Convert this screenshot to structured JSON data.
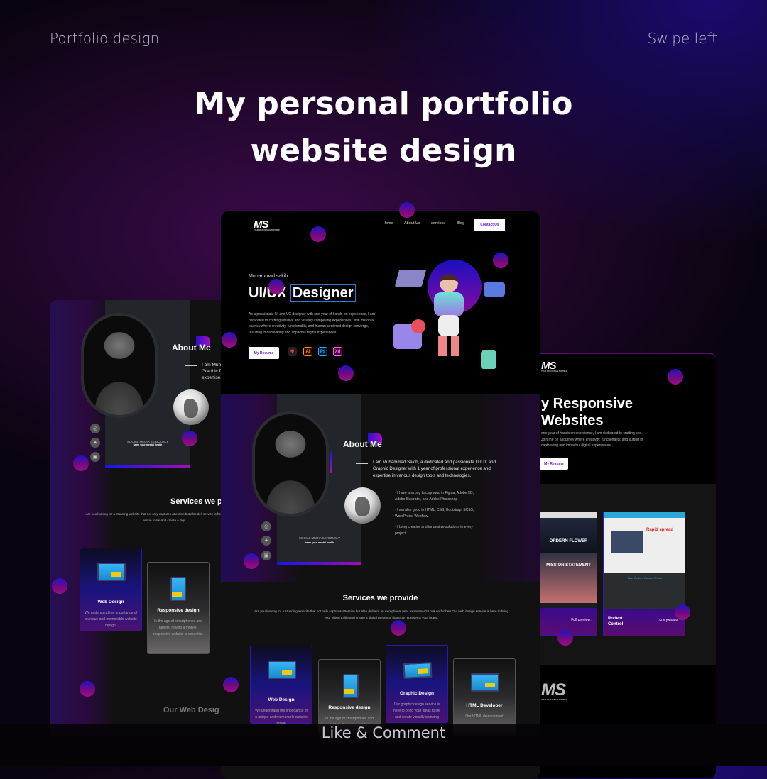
{
  "header": {
    "left_label": "Portfolio design",
    "right_label": "Swipe left",
    "title_line1": "My personal portfolio",
    "title_line2": "website design"
  },
  "footer": {
    "cta": "Like & Comment"
  },
  "site": {
    "logo": "MS",
    "logo_tagline": "YOUR WEB DESIGN PARTNER",
    "nav": [
      "Home",
      "About Us",
      "services",
      "Blog"
    ],
    "contact_button": "Contact Us",
    "hero": {
      "name": "Muhammad sakib",
      "role_prefix": "UI/UX",
      "role_highlight": "Designer",
      "description": "As a passionate UI and UX designer with one year of hands-on experience, I am dedicated to crafting intuitive and visually compelling experiences. Join me on a journey where creativity, functionality, and human-centered design converge, resulting in captivating and impactful digital experiences.",
      "resume_button": "My Resume",
      "tools": [
        {
          "name": "figma-icon",
          "label": ""
        },
        {
          "name": "illustrator-icon",
          "label": "Ai"
        },
        {
          "name": "photoshop-icon",
          "label": "Ps"
        },
        {
          "name": "xd-icon",
          "label": "Xd"
        }
      ]
    },
    "about": {
      "title": "About Me",
      "intro": "I am Muhammad Sakib, a dedicated and passionate UI/UX and Graphic Designer with 1 year of professional experience and expertise in various design tools and technologies.",
      "intro_partial": [
        "I am Muh",
        "Graphic D",
        "expertise"
      ],
      "bullets": [
        "I have a strong background in Figma, Adobe XD, Adobe Illustrator, and Adobe Photoshop .",
        "I am also good in HTML, CSS, Bootstrap, SCSS, WordPress, Webflow.",
        "I bring creative and innovative solutions to every project."
      ],
      "social_caption": "SOCIAL MEDIA SERIOUSLY",
      "social_sub": "harm your mental health",
      "socials": [
        "instagram-icon",
        "twitter-icon",
        "facebook-icon"
      ]
    },
    "services": {
      "title": "Services we provide",
      "title_partial": "Services we p",
      "description": "Are you looking for a stunning website that not only captures attention but also delivers an exceptional user experience? Look no further! Our web design service is here to bring your vision to life and create a digital presence that truly represents your brand.",
      "description_partial": "Are you looking for a stunning website that not only captures attention but also deli service is here to bring your vision to life and create a digi",
      "cards": [
        {
          "title": "Web Design",
          "text": "We understand the importance of a unique and memorable website design."
        },
        {
          "title": "Responsive design",
          "text": "In the age of smartphones and tablets, having a mobile-responsive website is essential."
        },
        {
          "title": "Graphic Design",
          "text": "Our graphic design service is here to bring your ideas to life and create visually stunning"
        },
        {
          "title": "HTML Developer",
          "text": "Our HTML development"
        }
      ]
    },
    "web_design_heading": "Our Web Desig",
    "responsive": {
      "line1": "y Responsive",
      "line2": "Websites",
      "description": "one year of hands on experience, I am dedicated to crafting ces. Join me on a journey where creativity, functionality, and sulting in captivating and impactful digital experiences.",
      "resume_button": "My Resume",
      "projects": [
        {
          "title": "",
          "preview": "Full preview",
          "shot_text": [
            "ORDERN FLOWER",
            "MISSION STATEMENT"
          ]
        },
        {
          "title": "Rodent Control",
          "preview": "Full preview",
          "shot_text": [
            "Rapid spread",
            "How Rodent Control Works"
          ]
        }
      ]
    }
  },
  "colors": {
    "accent": "#6a1bd8",
    "gradient_blue": "#1515f0",
    "gradient_purple": "#a010b0"
  }
}
